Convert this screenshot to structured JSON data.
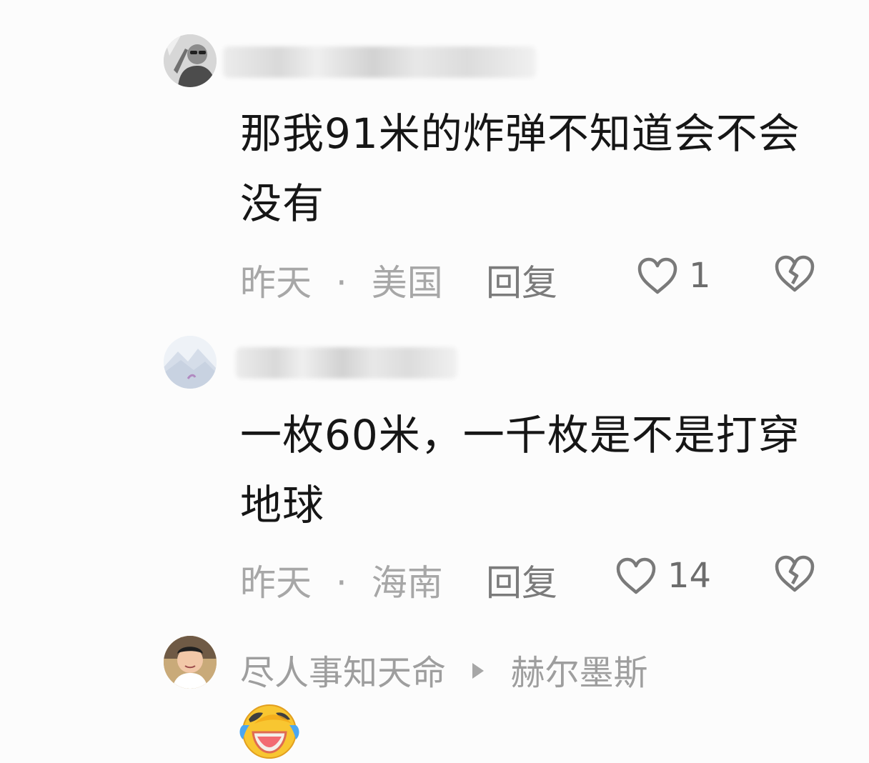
{
  "comments": [
    {
      "username": "",
      "text": "那我91米的炸弹不知道会不会没有",
      "time": "昨天",
      "separator": "·",
      "location": "美国",
      "reply_label": "回复",
      "likes": "1"
    },
    {
      "username": "",
      "text": "一枚60米，一千枚是不是打穿地球",
      "time": "昨天",
      "separator": "·",
      "location": "海南",
      "reply_label": "回复",
      "likes": "14"
    },
    {
      "username": "尽人事知天命",
      "reply_to": "赫尔墨斯",
      "emoji": "laughing-crying-emoji"
    }
  ],
  "colors": {
    "background": "#fcfcfc",
    "text": "#161616",
    "meta": "#a7a7a7",
    "reply": "#7b7b7b",
    "icon": "#7a7a7a"
  }
}
